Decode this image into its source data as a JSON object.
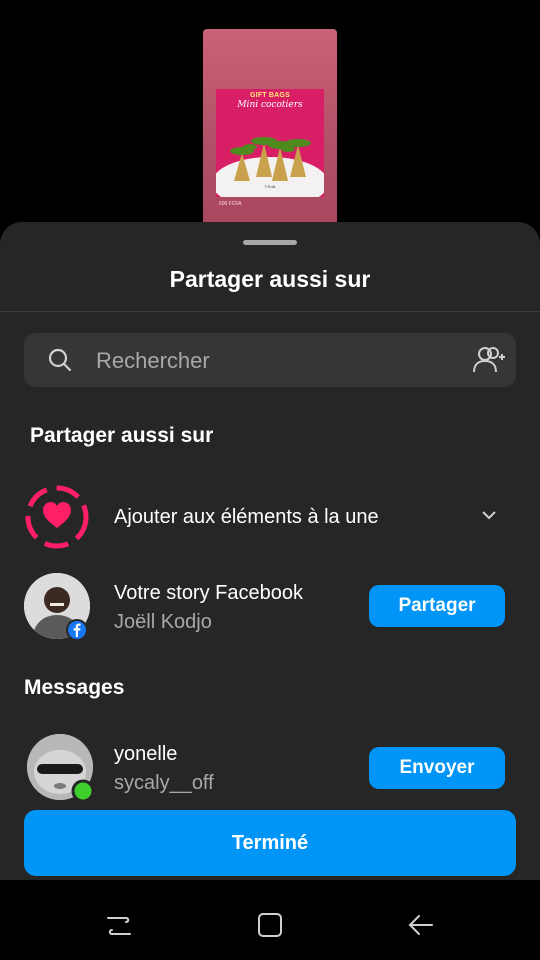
{
  "story_preview": {
    "poster_title": "GIFT BAGS",
    "poster_subtitle": "Mini cocotiers",
    "poster_brand": "T.Rolk",
    "poster_price": "500 FCFA"
  },
  "sheet": {
    "title": "Partager aussi sur",
    "search_placeholder": "Rechercher"
  },
  "share_section": {
    "label": "Partager aussi sur",
    "highlight_label": "Ajouter aux éléments à la une",
    "facebook_title": "Votre story Facebook",
    "facebook_user": "Joëll Kodjo",
    "share_button": "Partager"
  },
  "messages": {
    "label": "Messages",
    "contact_name": "yonelle",
    "contact_handle": "sycaly__off",
    "send_button": "Envoyer"
  },
  "done_button": "Terminé",
  "colors": {
    "accent": "#0095f6",
    "highlight_pink": "#ff1f66",
    "online": "#3fcf2c",
    "facebook": "#1877f2"
  }
}
